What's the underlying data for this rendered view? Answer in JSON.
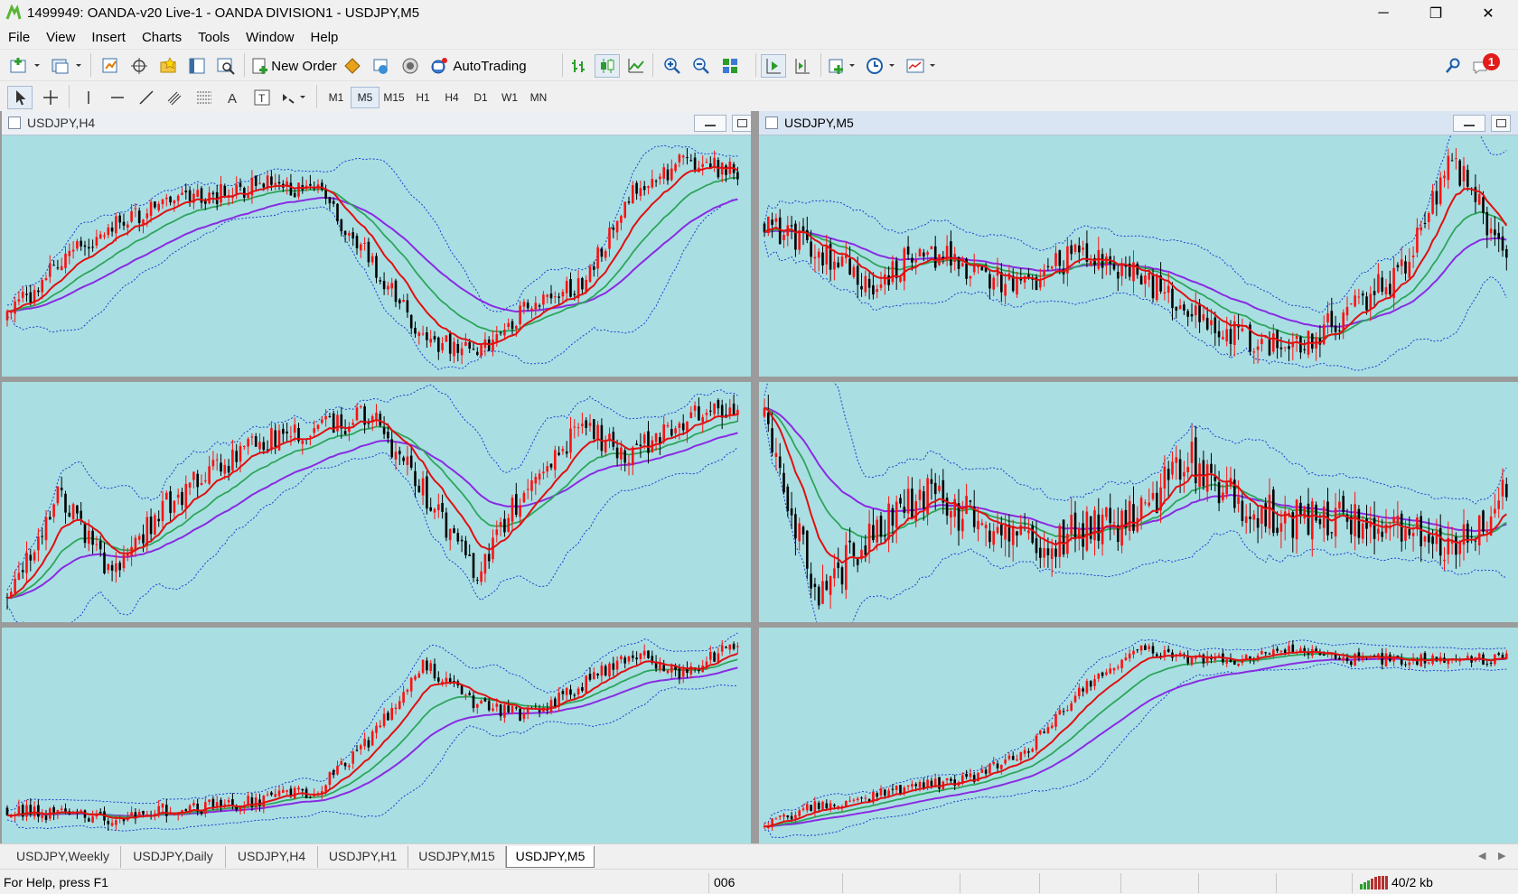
{
  "window": {
    "title": "1499949: OANDA-v20 Live-1 - OANDA DIVISION1 - USDJPY,M5",
    "minimize": "─",
    "maximize": "❐",
    "close": "✕"
  },
  "menu": [
    "File",
    "View",
    "Insert",
    "Charts",
    "Tools",
    "Window",
    "Help"
  ],
  "toolbar": {
    "new_order_label": "New Order",
    "autotrading_label": "AutoTrading",
    "notification_count": "1"
  },
  "timeframes": [
    "M1",
    "M5",
    "M15",
    "H1",
    "H4",
    "D1",
    "W1",
    "MN"
  ],
  "selected_timeframe": "M5",
  "charts": [
    {
      "title": "USDJPY,H4",
      "active": false
    },
    {
      "title": "USDJPY,M5",
      "active": true
    }
  ],
  "tabs": [
    "USDJPY,Weekly",
    "USDJPY,Daily",
    "USDJPY,H4",
    "USDJPY,H1",
    "USDJPY,M15",
    "USDJPY,M5"
  ],
  "active_tab": "USDJPY,M5",
  "status": {
    "help": "For Help, press F1",
    "profile": "006",
    "traffic": "40/2 kb"
  },
  "colors": {
    "chart_bg": "#a9dfe3",
    "bull_candle": "#ff1010",
    "bear_candle": "#000000",
    "ma_fast": "#e01010",
    "ma_mid": "#2ea55a",
    "ma_slow": "#8a2be2",
    "bands": "#1f3fd0"
  }
}
